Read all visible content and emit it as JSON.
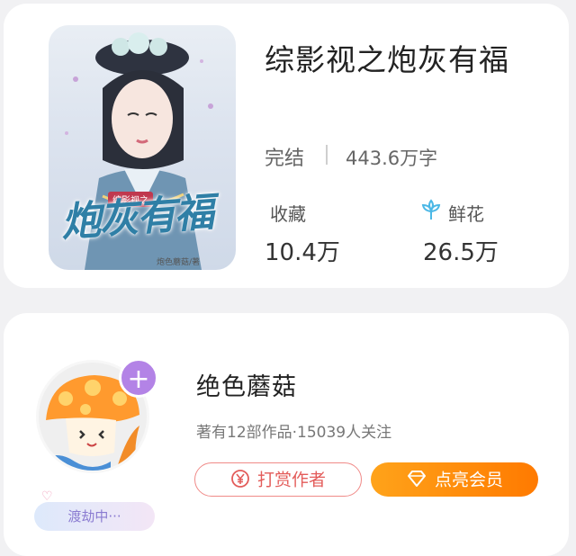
{
  "book": {
    "title": "综影视之炮灰有福",
    "status": "完结",
    "word_count": "443.6万字",
    "cover": {
      "title_art": "炮灰有福",
      "series_tag": "综影视之",
      "author_credit": "炮色蘑菇/著"
    },
    "stats": {
      "favorites": {
        "label": "收藏",
        "value": "10.4万"
      },
      "flowers": {
        "label": "鲜花",
        "value": "26.5万",
        "icon": "flower-icon"
      }
    }
  },
  "author": {
    "name": "绝色蘑菇",
    "meta": "著有12部作品·15039人关注",
    "level_badge": "渡劫中···",
    "follow_icon": "plus-icon",
    "buttons": {
      "tip": {
        "label": "打赏作者",
        "icon": "yen-coin-icon"
      },
      "vip": {
        "label": "点亮会员",
        "icon": "diamond-icon"
      }
    }
  },
  "colors": {
    "tip_accent": "#e35c5a",
    "vip_gradient_start": "#ffa31a",
    "vip_gradient_end": "#ff7a00",
    "follow_badge": "#b383e6",
    "flower_icon": "#4cb8e6"
  }
}
